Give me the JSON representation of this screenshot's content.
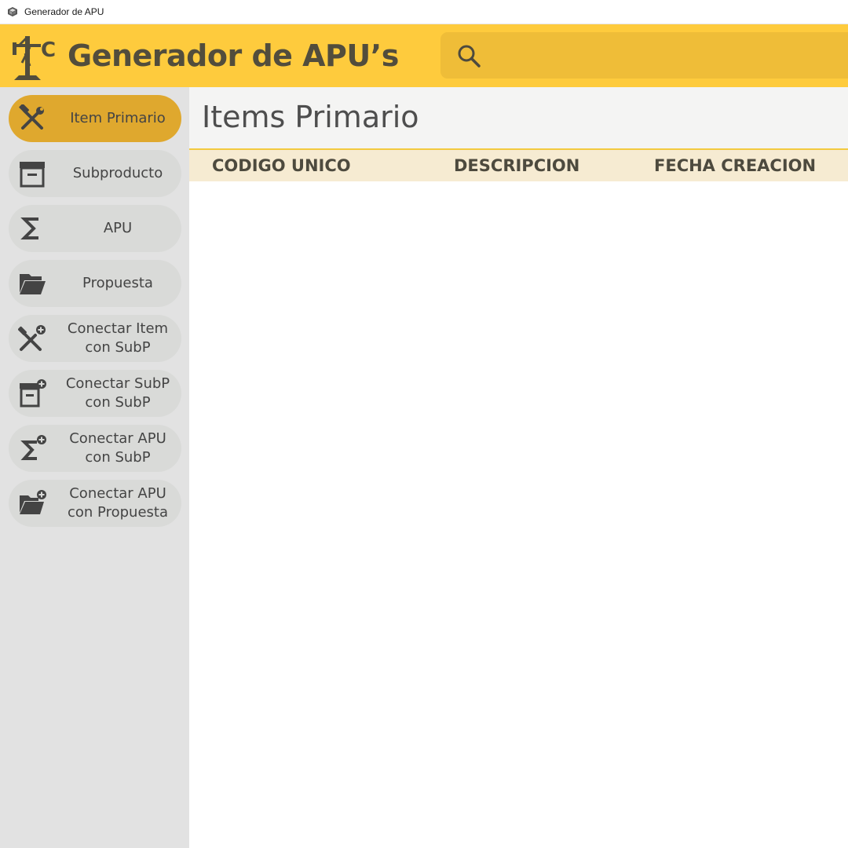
{
  "window": {
    "title": "Generador de APU"
  },
  "header": {
    "brand": "Generador de APU’s",
    "search": {
      "placeholder": "",
      "value": ""
    }
  },
  "sidebar": {
    "items": [
      {
        "label": "Item Primario",
        "icon": "tools-icon",
        "active": true
      },
      {
        "label": "Subproducto",
        "icon": "archive-icon",
        "active": false
      },
      {
        "label": "APU",
        "icon": "sigma-icon",
        "active": false
      },
      {
        "label": "Propuesta",
        "icon": "folder-open-icon",
        "active": false
      },
      {
        "label": "Conectar Item\ncon SubP",
        "icon": "tools-add-icon",
        "active": false
      },
      {
        "label": "Conectar SubP\ncon SubP",
        "icon": "archive-add-icon",
        "active": false
      },
      {
        "label": "Conectar APU\ncon SubP",
        "icon": "sigma-add-icon",
        "active": false
      },
      {
        "label": "Conectar APU\ncon Propuesta",
        "icon": "folder-add-icon",
        "active": false
      }
    ]
  },
  "main": {
    "title": "Items Primario",
    "table": {
      "columns": [
        "CODIGO UNICO",
        "DESCRIPCION",
        "FECHA CREACION"
      ],
      "rows": []
    }
  },
  "colors": {
    "header_bg": "#fecb3d",
    "search_bg": "#efbd38",
    "active_nav": "#dfa82e",
    "sidebar_bg": "#e2e2e2",
    "table_header_bg": "#f6ebd2",
    "text_dark": "#524d3c"
  }
}
